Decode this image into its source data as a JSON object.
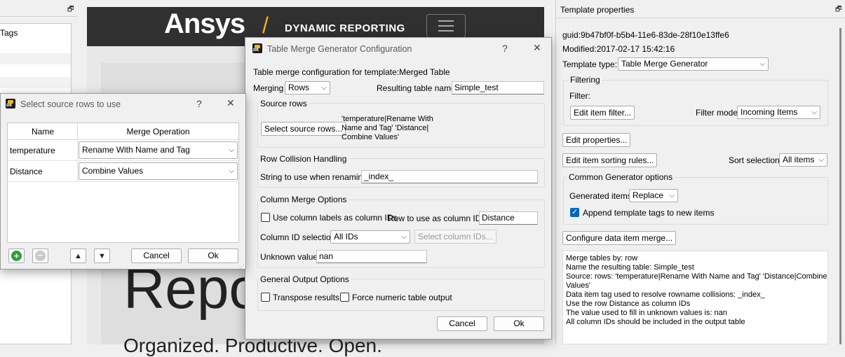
{
  "left_panel": {
    "item": "Tags"
  },
  "web": {
    "brand": "Ansys",
    "slash": "/",
    "product": "DYNAMIC REPORTING",
    "big_text": "Repo",
    "tagline": "Organized. Productive. Open."
  },
  "template_properties": {
    "title": "Template properties",
    "guid": "guid:9b47bf0f-b5b4-11e6-83de-28f10e13ffe6",
    "modified": "Modified:2017-02-17 15:42:16",
    "template_type_label": "Template type:",
    "template_type_value": "Table Merge Generator",
    "filtering_title": "Filtering",
    "filter_label": "Filter:",
    "edit_item_filter": "Edit item filter...",
    "filter_mode_label": "Filter mode",
    "filter_mode_value": "Incoming Items",
    "edit_properties": "Edit properties...",
    "edit_item_sorting": "Edit item sorting rules...",
    "sort_selection_label": "Sort selection",
    "sort_selection_value": "All items",
    "common_title": "Common Generator options",
    "generated_items_label": "Generated items",
    "generated_items_value": "Replace",
    "append_tags_label": "Append template tags to new items",
    "append_tags_checked": true,
    "configure_merge": "Configure data item merge...",
    "summary": [
      "Merge tables by: row",
      "Name the resulting table: Simple_test",
      "Source: rows: 'temperature|Rename With Name and Tag' 'Distance|Combine",
      "Values'",
      "Data item tag used to resolve rowname collisions: _index_",
      "Use the row Distance as column IDs",
      "The value used to fill in unknown values is: nan",
      "All column IDs should be included in the output table"
    ]
  },
  "merge_dialog": {
    "title": "Table Merge Generator Configuration",
    "help": "?",
    "close": "✕",
    "config_line": "Table merge configuration for template:Merged Table",
    "merging_label": "Merging",
    "merging_value": "Rows",
    "result_name_label": "Resulting table name",
    "result_name_value": "Simple_test",
    "source_rows_title": "Source rows",
    "select_source_rows": "Select source rows...",
    "source_rows_text_1": "'temperature|Rename With",
    "source_rows_text_2": "Name and Tag' 'Distance|",
    "source_rows_text_3": "Combine Values'",
    "collision_title": "Row Collision Handling",
    "rename_label": "String to use when renaming",
    "rename_value": "_index_",
    "column_merge_title": "Column Merge Options",
    "use_col_labels": "Use column labels as column IDs",
    "row_as_ids_label": "Row to use as column IDs",
    "row_as_ids_value": "Distance",
    "col_id_sel_label": "Column ID selection",
    "col_id_sel_value": "All IDs",
    "select_col_ids": "Select column IDs...",
    "unknown_label": "Unknown value",
    "unknown_value": "nan",
    "general_title": "General Output Options",
    "transpose": "Transpose results",
    "force_numeric": "Force numeric table output",
    "cancel": "Cancel",
    "ok": "Ok"
  },
  "source_dialog": {
    "title": "Select source rows to use",
    "help": "?",
    "close": "✕",
    "headers": [
      "Name",
      "Merge Operation"
    ],
    "rows": [
      {
        "name": "temperature",
        "op": "Rename With Name and Tag"
      },
      {
        "name": "Distance",
        "op": "Combine Values"
      }
    ],
    "cancel": "Cancel",
    "ok": "Ok"
  },
  "colors": {
    "ansys_gold": "#f5b21a",
    "header_dark": "#303030",
    "add_green": "#2e9e3b",
    "check_blue": "#0067c0"
  }
}
